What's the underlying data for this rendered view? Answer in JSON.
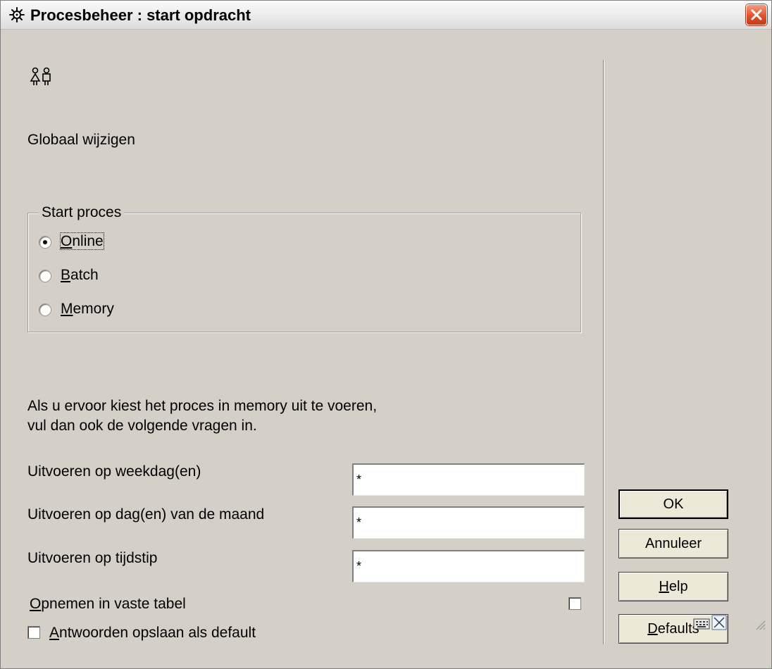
{
  "window": {
    "title": "Procesbeheer : start opdracht",
    "title_icon": "gear-icon",
    "close_icon": "close-icon"
  },
  "form": {
    "header_icon": "people-icon",
    "heading": "Globaal wijzigen",
    "start_group": {
      "legend": "Start proces",
      "options": [
        {
          "label": "Online",
          "mnemonic": "O",
          "rest": "nline",
          "selected": true
        },
        {
          "label": "Batch",
          "mnemonic": "B",
          "rest": "atch",
          "selected": false
        },
        {
          "label": "Memory",
          "mnemonic": "M",
          "rest": "emory",
          "selected": false
        }
      ]
    },
    "info_line1": "Als u ervoor kiest het proces in memory uit te voeren,",
    "info_line2": "vul dan ook de volgende vragen in.",
    "weekday_label": "Uitvoeren op weekdag(en)",
    "weekday_value": "*",
    "monthday_label": "Uitvoeren op dag(en) van de maand",
    "monthday_value": "*",
    "time_label": "Uitvoeren op tijdstip",
    "time_value": "*",
    "fixed_table_label_mnemonic": "O",
    "fixed_table_label_rest": "pnemen in vaste tabel",
    "fixed_table_checked": false,
    "save_defaults_mnemonic": "A",
    "save_defaults_rest": "ntwoorden opslaan als default",
    "save_defaults_checked": false
  },
  "buttons": {
    "ok": "OK",
    "cancel": "Annuleer",
    "help_mnemonic": "H",
    "help_rest": "elp",
    "defaults_mnemonic": "D",
    "defaults_rest": "efaults"
  },
  "statusbar": {
    "icons": [
      "keyboard-icon",
      "resize-icon"
    ]
  }
}
